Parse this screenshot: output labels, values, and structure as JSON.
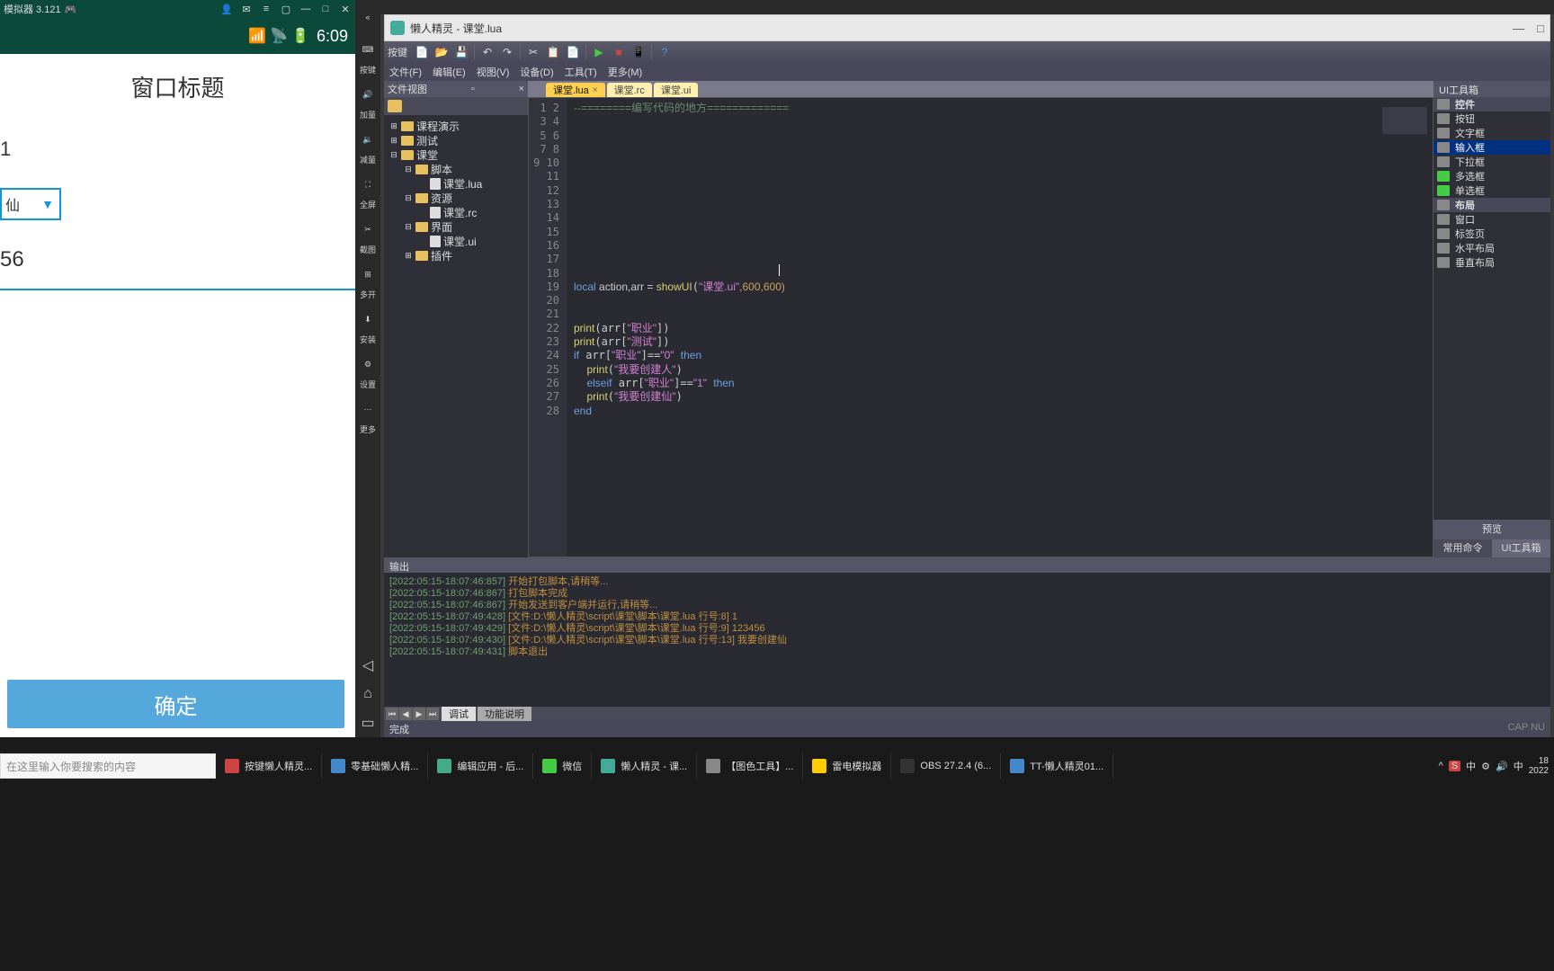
{
  "emulator": {
    "titlebar": "模拟器 3.121",
    "time": "6:09",
    "window_title": "窗口标题",
    "field1": "1",
    "field2": "56",
    "confirm": "确定"
  },
  "emu_tools": {
    "btn1": "按键",
    "btn2": "加量",
    "btn3": "减量",
    "btn4": "全屏",
    "btn5": "截图",
    "btn6": "多开",
    "btn7": "安装",
    "btn8": "设置",
    "btn9": "更多"
  },
  "ide": {
    "title": "懒人精灵 - 课堂.lua",
    "toolbar_label": "按键",
    "menus": {
      "file": "文件(F)",
      "edit": "编辑(E)",
      "view": "视图(V)",
      "device": "设备(D)",
      "tools": "工具(T)",
      "more": "更多(M)"
    },
    "file_panel_title": "文件视图",
    "tree": {
      "n0": "课程演示",
      "n1": "测试",
      "n2": "课堂",
      "n3": "脚本",
      "n3a": "课堂.lua",
      "n4": "资源",
      "n4a": "课堂.rc",
      "n5": "界面",
      "n5a": "课堂.ui",
      "n6": "插件"
    },
    "tabs": {
      "t0": "课堂.lua",
      "t1": "课堂.rc",
      "t2": "课堂.ui"
    },
    "code": {
      "l1_cmt": "--========编写代码的地方=============",
      "l14_kw": "local",
      "l14_ids": " action,arr = ",
      "l14_fn": "showUI",
      "l14_str": "\"课堂.ui\"",
      "l14_rest": ",600,600)",
      "l17_fn": "print",
      "l17_str": "\"职业\"",
      "l18_fn": "print",
      "l18_str": "\"测试\"",
      "l19_kw": "if",
      "l19_str1": "\"职业\"",
      "l19_str2": "\"0\"",
      "l19_kw2": "then",
      "l20_fn": "print",
      "l20_str": "\"我要创建人\"",
      "l21_kw": "elseif",
      "l21_str1": "\"职业\"",
      "l21_str2": "\"1\"",
      "l21_kw2": "then",
      "l22_fn": "print",
      "l22_str": "\"我要创建仙\"",
      "l23_kw": "end"
    },
    "toolbox": {
      "title": "UI工具箱",
      "cat1": "控件",
      "btn": "按钮",
      "text": "文字框",
      "input": "输入框",
      "dropdown": "下拉框",
      "multi": "多选框",
      "single": "单选框",
      "cat2": "布局",
      "window": "窗口",
      "tab": "标签页",
      "hlayout": "水平布局",
      "vlayout": "垂直布局",
      "preview": "预览",
      "tab1": "常用命令",
      "tab2": "UI工具箱"
    },
    "output": {
      "title": "输出",
      "lines": [
        {
          "ts": "[2022:05:15-18:07:46:857]",
          "msg": " 开始打包脚本,请稍等..."
        },
        {
          "ts": "[2022:05:15-18:07:46:867]",
          "msg": " 打包脚本完成"
        },
        {
          "ts": "[2022:05:15-18:07:46:867]",
          "msg": " 开始发送到客户端并运行,请稍等..."
        },
        {
          "ts": "[2022:05:15-18:07:49:428]",
          "msg": " [文件:D:\\懒人精灵\\script\\课堂\\脚本\\课堂.lua 行号:8] 1"
        },
        {
          "ts": "[2022:05:15-18:07:49:429]",
          "msg": " [文件:D:\\懒人精灵\\script\\课堂\\脚本\\课堂.lua 行号:9] 123456"
        },
        {
          "ts": "[2022:05:15-18:07:49:430]",
          "msg": " [文件:D:\\懒人精灵\\script\\课堂\\脚本\\课堂.lua 行号:13] 我要创建仙"
        },
        {
          "ts": "[2022:05:15-18:07:49:431]",
          "msg": " 脚本退出"
        }
      ],
      "nav_tab1": "调试",
      "nav_tab2": "功能说明",
      "status": "完成",
      "status_r": "CAP  NU"
    }
  },
  "search_placeholder": "在这里输入你要搜索的内容",
  "taskbar": {
    "t0": "按键懒人精灵...",
    "t1": "零基础懒人精...",
    "t2": "编辑应用 - 后...",
    "t3": "微信",
    "t4": "懒人精灵 - 课...",
    "t5": "【图色工具】...",
    "t6": "雷电模拟器",
    "t7": "OBS 27.2.4 (6...",
    "t8": "TT-懒人精灵01...",
    "tray_ime": "中",
    "date1": "18",
    "date2": "2022"
  }
}
